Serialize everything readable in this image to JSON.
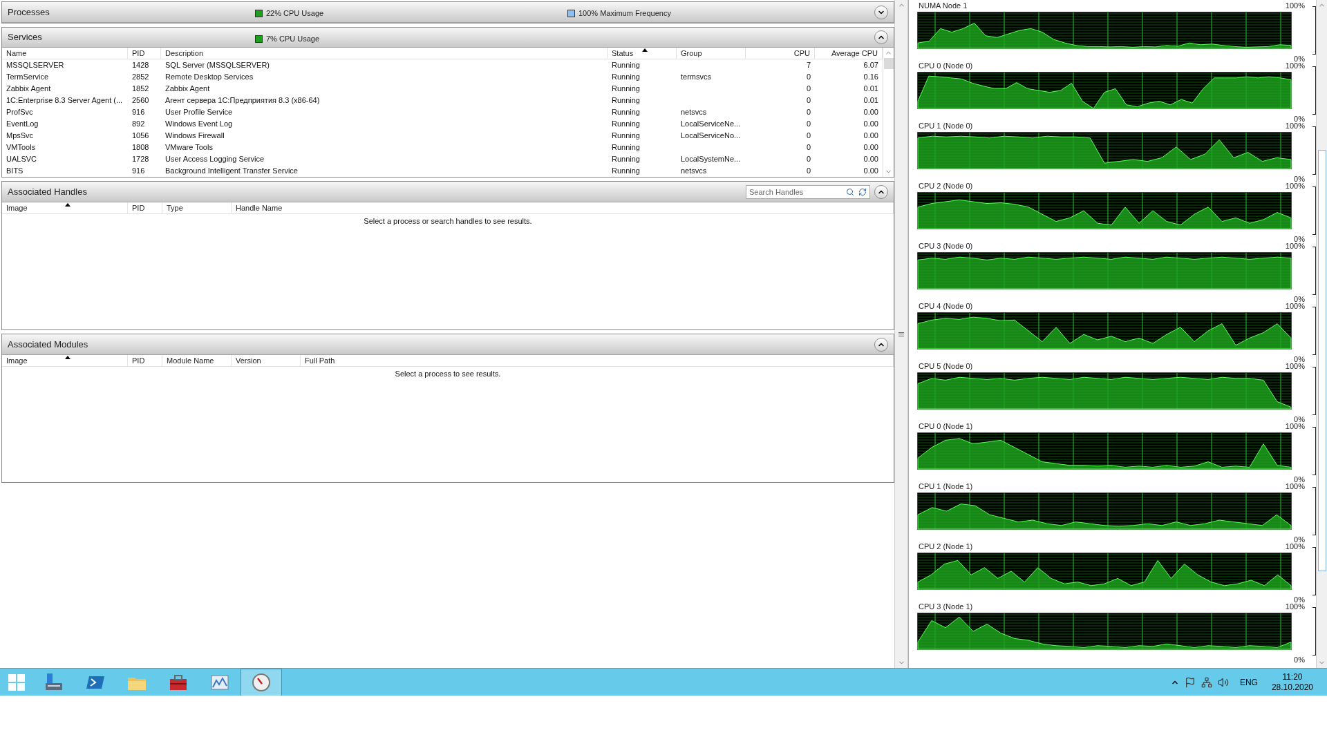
{
  "processes": {
    "title": "Processes",
    "expanded": false,
    "indicators": [
      {
        "label": "22% CPU Usage",
        "color": "#1f9e1f"
      },
      {
        "label": "100% Maximum Frequency",
        "color": "#8fbef0"
      }
    ]
  },
  "services": {
    "title": "Services",
    "expanded": true,
    "indicators": [
      {
        "label": "7% CPU Usage",
        "color": "#1f9e1f"
      }
    ],
    "columns": [
      {
        "label": "Name",
        "sorted": false
      },
      {
        "label": "PID",
        "sorted": false
      },
      {
        "label": "Description",
        "sorted": false
      },
      {
        "label": "Status",
        "sorted": true
      },
      {
        "label": "Group",
        "sorted": false
      },
      {
        "label": "CPU",
        "sorted": false
      },
      {
        "label": "Average CPU",
        "sorted": false
      }
    ],
    "rows": [
      [
        "MSSQLSERVER",
        "1428",
        "SQL Server (MSSQLSERVER)",
        "Running",
        "",
        "7",
        "6.07"
      ],
      [
        "TermService",
        "2852",
        "Remote Desktop Services",
        "Running",
        "termsvcs",
        "0",
        "0.16"
      ],
      [
        "Zabbix Agent",
        "1852",
        "Zabbix Agent",
        "Running",
        "",
        "0",
        "0.01"
      ],
      [
        "1C:Enterprise 8.3 Server Agent (...",
        "2560",
        "Агент сервера 1С:Предприятия 8.3 (x86-64)",
        "Running",
        "",
        "0",
        "0.01"
      ],
      [
        "ProfSvc",
        "916",
        "User Profile Service",
        "Running",
        "netsvcs",
        "0",
        "0.00"
      ],
      [
        "EventLog",
        "892",
        "Windows Event Log",
        "Running",
        "LocalServiceNe...",
        "0",
        "0.00"
      ],
      [
        "MpsSvc",
        "1056",
        "Windows Firewall",
        "Running",
        "LocalServiceNo...",
        "0",
        "0.00"
      ],
      [
        "VMTools",
        "1808",
        "VMware Tools",
        "Running",
        "",
        "0",
        "0.00"
      ],
      [
        "UALSVC",
        "1728",
        "User Access Logging Service",
        "Running",
        "LocalSystemNe...",
        "0",
        "0.00"
      ],
      [
        "BITS",
        "916",
        "Background Intelligent Transfer Service",
        "Running",
        "netsvcs",
        "0",
        "0.00"
      ]
    ]
  },
  "handles": {
    "title": "Associated Handles",
    "expanded": true,
    "search": {
      "placeholder": "Search Handles"
    },
    "columns": [
      {
        "label": "Image",
        "sorted": true
      },
      {
        "label": "PID",
        "sorted": false
      },
      {
        "label": "Type",
        "sorted": false
      },
      {
        "label": "Handle Name",
        "sorted": false
      }
    ],
    "message": "Select a process or search handles to see results."
  },
  "modules": {
    "title": "Associated Modules",
    "expanded": true,
    "columns": [
      {
        "label": "Image",
        "sorted": true
      },
      {
        "label": "PID",
        "sorted": false
      },
      {
        "label": "Module Name",
        "sorted": false
      },
      {
        "label": "Version",
        "sorted": false
      },
      {
        "label": "Full Path",
        "sorted": false
      }
    ],
    "message": "Select a process to see results."
  },
  "graphs": [
    {
      "title": "NUMA Node 1",
      "max_label": "100%",
      "min_label": "0%"
    },
    {
      "title": "CPU 0 (Node 0)",
      "max_label": "100%",
      "min_label": "0%"
    },
    {
      "title": "CPU 1 (Node 0)",
      "max_label": "100%",
      "min_label": "0%"
    },
    {
      "title": "CPU 2 (Node 0)",
      "max_label": "100%",
      "min_label": "0%"
    },
    {
      "title": "CPU 3 (Node 0)",
      "max_label": "100%",
      "min_label": "0%"
    },
    {
      "title": "CPU 4 (Node 0)",
      "max_label": "100%",
      "min_label": "0%"
    },
    {
      "title": "CPU 5 (Node 0)",
      "max_label": "100%",
      "min_label": "0%"
    },
    {
      "title": "CPU 0 (Node 1)",
      "max_label": "100%",
      "min_label": "0%"
    },
    {
      "title": "CPU 1 (Node 1)",
      "max_label": "100%",
      "min_label": "0%"
    },
    {
      "title": "CPU 2 (Node 1)",
      "max_label": "100%",
      "min_label": "0%"
    },
    {
      "title": "CPU 3 (Node 1)",
      "max_label": "100%",
      "min_label": "0%"
    }
  ],
  "taskbar": {
    "apps": [
      {
        "kind": "server-manager",
        "selected": false
      },
      {
        "kind": "powershell",
        "selected": false
      },
      {
        "kind": "explorer",
        "selected": false
      },
      {
        "kind": "toolbox",
        "selected": false
      },
      {
        "kind": "performance",
        "selected": false
      },
      {
        "kind": "gauge",
        "selected": true
      }
    ],
    "language": "ENG",
    "time": "11:20",
    "date": "28.10.2020"
  }
}
